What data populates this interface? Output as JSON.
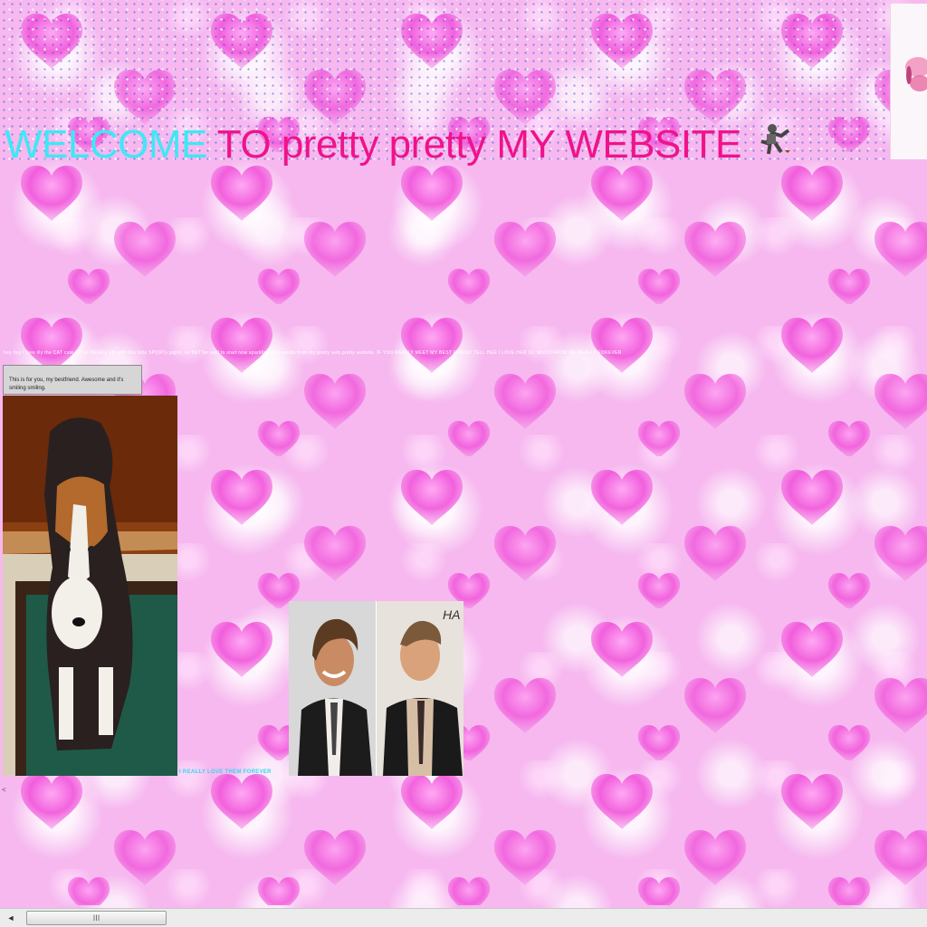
{
  "header": {
    "welcome_word": "WELCOME",
    "rest_title": "TO pretty pretty MY WEBSITE"
  },
  "marquee": {
    "text": "hey hey i love lily the CAT cute EY so BEARly EB with this little SPORTy piglet, let BETTer wait to start now sparkling cute words from my pretty web pretty website. IF YOU REALLY MEET MY BEST FRIEND TELL HER I LOVE HER SO MUCH FROM ME REALLY FOREVER"
  },
  "note": {
    "text": "This is for you, my bestfriend. Awesome and it's smiling smiling."
  },
  "caption": {
    "text": "I REALLY LOVE THEM FOREVER"
  },
  "misc": {
    "stray_mark": "<"
  },
  "scrollbar": {
    "left_arrow": "◄",
    "grip": "III"
  },
  "colors": {
    "welcome": "#3ee8f4",
    "title": "#ef138a",
    "heart": "#f04ad8",
    "background": "#f6b8ef"
  },
  "icons": {
    "hearts": "heart-icon",
    "dancer": "dancer-icon"
  }
}
